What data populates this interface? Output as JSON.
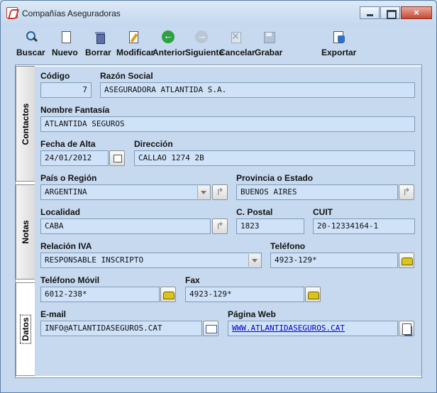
{
  "window": {
    "title": "Compañías Aseguradoras",
    "close_glyph": "×"
  },
  "toolbar": {
    "buscar": "Buscar",
    "nuevo": "Nuevo",
    "borrar": "Borrar",
    "modificar": "Modificar",
    "anterior": "Anterior",
    "siguiente": "Siguiente",
    "cancelar": "Cancelar",
    "grabar": "Grabar",
    "exportar": "Exportar"
  },
  "tabs": {
    "contactos": "Contactos",
    "notas": "Notas",
    "datos": "Datos"
  },
  "form": {
    "codigo_label": "Código",
    "codigo": "7",
    "razon_label": "Razón Social",
    "razon": "ASEGURADORA ATLANTIDA S.A.",
    "fantasia_label": "Nombre Fantasía",
    "fantasia": "ATLANTIDA SEGUROS",
    "alta_label": "Fecha de Alta",
    "alta": "24/01/2012",
    "direccion_label": "Dirección",
    "direccion": "CALLAO 1274 2B",
    "pais_label": "País o Región",
    "pais": "ARGENTINA",
    "provincia_label": "Provincia o Estado",
    "provincia": "BUENOS AIRES",
    "localidad_label": "Localidad",
    "localidad": "CABA",
    "cpostal_label": "C. Postal",
    "cpostal": "1823",
    "cuit_label": "CUIT",
    "cuit": "20-12334164-1",
    "iva_label": "Relación IVA",
    "iva": "RESPONSABLE INSCRIPTO",
    "telefono_label": "Teléfono",
    "telefono": "4923-129*",
    "movil_label": "Teléfono Móvil",
    "movil": "6012-238*",
    "fax_label": "Fax",
    "fax": "4923-129*",
    "email_label": "E-mail",
    "email": "INFO@ATLANTIDASEGUROS.CAT",
    "web_label": "Página Web",
    "web": "WWW.ATLANTIDASEGUROS.CAT"
  }
}
